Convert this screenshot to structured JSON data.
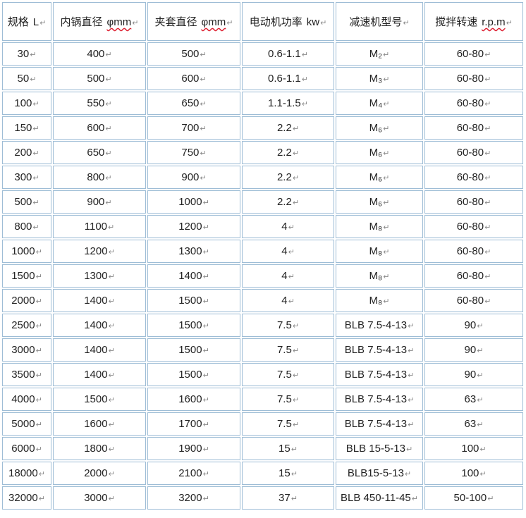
{
  "headers": [
    {
      "label": "规格",
      "unit": "L"
    },
    {
      "label": "内锅直径",
      "unit": "φmm"
    },
    {
      "label": "夹套直径",
      "unit": "φmm"
    },
    {
      "label": "电动机功率",
      "unit": "kw"
    },
    {
      "label": "减速机型号",
      "unit": ""
    },
    {
      "label": "搅拌转速",
      "unit": "r.p.m"
    }
  ],
  "para_mark": "↵",
  "rows": [
    [
      "30",
      "400",
      "500",
      "0.6-1.1",
      "M₂",
      "60-80"
    ],
    [
      "50",
      "500",
      "600",
      "0.6-1.1",
      "M₃",
      "60-80"
    ],
    [
      "100",
      "550",
      "650",
      "1.1-1.5",
      "M₄",
      "60-80"
    ],
    [
      "150",
      "600",
      "700",
      "2.2",
      "M₆",
      "60-80"
    ],
    [
      "200",
      "650",
      "750",
      "2.2",
      "M₆",
      "60-80"
    ],
    [
      "300",
      "800",
      "900",
      "2.2",
      "M₆",
      "60-80"
    ],
    [
      "500",
      "900",
      "1000",
      "2.2",
      "M₆",
      "60-80"
    ],
    [
      "800",
      "1100",
      "1200",
      "4",
      "M₈",
      "60-80"
    ],
    [
      "1000",
      "1200",
      "1300",
      "4",
      "M₈",
      "60-80"
    ],
    [
      "1500",
      "1300",
      "1400",
      "4",
      "M₈",
      "60-80"
    ],
    [
      "2000",
      "1400",
      "1500",
      "4",
      "M₈",
      "60-80"
    ],
    [
      "2500",
      "1400",
      "1500",
      "7.5",
      "BLB 7.5-4-13",
      "90"
    ],
    [
      "3000",
      "1400",
      "1500",
      "7.5",
      "BLB 7.5-4-13",
      "90"
    ],
    [
      "3500",
      "1400",
      "1500",
      "7.5",
      "BLB 7.5-4-13",
      "90"
    ],
    [
      "4000",
      "1500",
      "1600",
      "7.5",
      "BLB 7.5-4-13",
      "63"
    ],
    [
      "5000",
      "1600",
      "1700",
      "7.5",
      "BLB 7.5-4-13",
      "63"
    ],
    [
      "6000",
      "1800",
      "1900",
      "15",
      "BLB 15-5-13",
      "100"
    ],
    [
      "18000",
      "2000",
      "2100",
      "15",
      "BLB15-5-13",
      "100"
    ],
    [
      "32000",
      "3000",
      "3200",
      "37",
      "BLB 450-11-45",
      "50-100"
    ]
  ]
}
